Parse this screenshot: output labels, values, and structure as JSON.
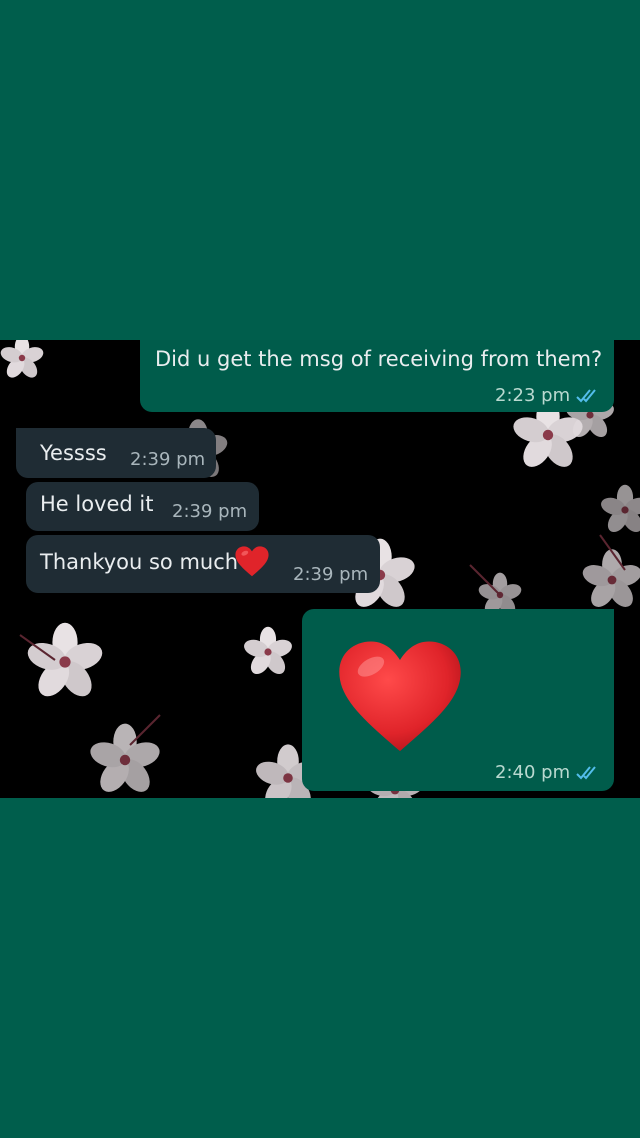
{
  "colors": {
    "background": "#005e4c",
    "chat_background": "#000000",
    "incoming_bubble": "#1f2c34",
    "outgoing_bubble": "#005c4b",
    "read_ticks": "#53bdeb",
    "heart": "#e0242a"
  },
  "messages": [
    {
      "direction": "outgoing",
      "text": "Did u get the msg of receiving from them?",
      "time": "2:23 pm",
      "status_icon": "double-check-read-icon"
    },
    {
      "direction": "incoming",
      "text": "Yessss",
      "time": "2:39 pm"
    },
    {
      "direction": "incoming",
      "text": "He loved it",
      "time": "2:39 pm"
    },
    {
      "direction": "incoming",
      "text": "Thankyou so much",
      "emoji": "red-heart-icon",
      "time": "2:39 pm"
    },
    {
      "direction": "outgoing",
      "emoji": "large-red-heart-icon",
      "time": "2:40 pm",
      "status_icon": "double-check-read-icon"
    }
  ]
}
